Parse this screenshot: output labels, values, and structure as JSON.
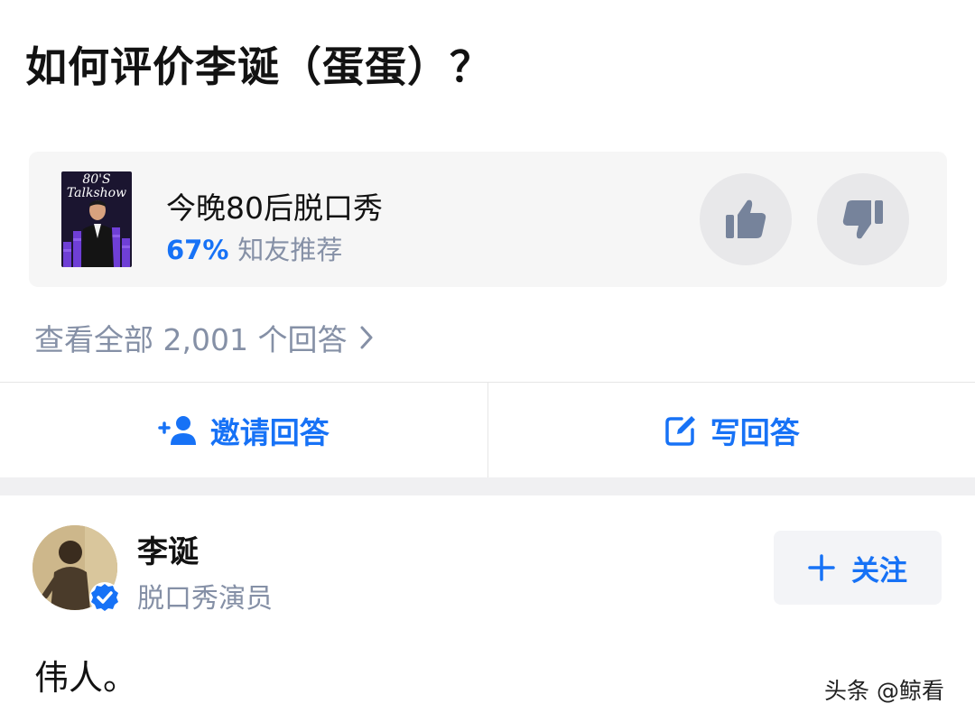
{
  "question": {
    "title": "如何评价李诞（蛋蛋）？"
  },
  "topic": {
    "cover_text": "80'S Talkshow",
    "name": "今晚80后脱口秀",
    "recommend_percent": "67%",
    "recommend_label": "知友推荐",
    "like_icon": "thumbs-up-icon",
    "dislike_icon": "thumbs-down-icon"
  },
  "answers_link": {
    "label": "查看全部 2,001 个回答"
  },
  "actions": {
    "invite_label": "邀请回答",
    "invite_icon": "add-person-icon",
    "write_label": "写回答",
    "write_icon": "edit-icon"
  },
  "author": {
    "name": "李诞",
    "bio": "脱口秀演员",
    "verified": true,
    "follow_label": "关注"
  },
  "answer": {
    "text": "伟人。"
  },
  "watermark": {
    "text": "头条 @鲸看"
  },
  "colors": {
    "accent": "#1772f6",
    "muted_text": "#8590a6",
    "card_bg": "#f6f6f6",
    "vote_bg": "#e8e8ea",
    "vote_icon": "#76839b"
  }
}
